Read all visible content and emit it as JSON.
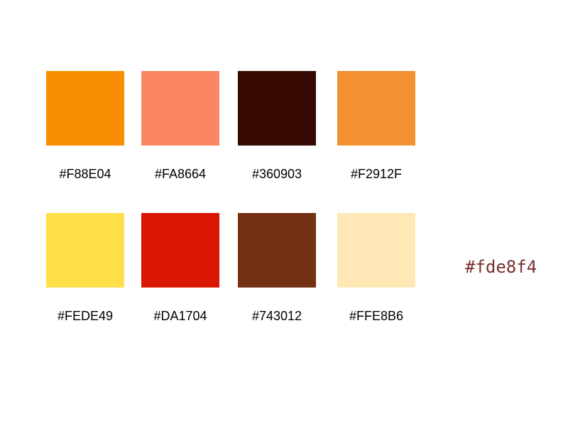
{
  "palette": {
    "swatches": [
      {
        "label": "#F88E04",
        "color": "#F88E04"
      },
      {
        "label": "#FA8664",
        "color": "#FA8664"
      },
      {
        "label": "#360903",
        "color": "#360903"
      },
      {
        "label": "#F2912F",
        "color": "#F2912F"
      },
      {
        "label": "#FEDE49",
        "color": "#FEDE49"
      },
      {
        "label": "#DA1704",
        "color": "#DA1704"
      },
      {
        "label": "#743012",
        "color": "#743012"
      },
      {
        "label": "#FFE8B6",
        "color": "#FFE8B6"
      }
    ]
  },
  "hex_code": {
    "text": "#fde8f4",
    "color": "#7a2f2f"
  }
}
